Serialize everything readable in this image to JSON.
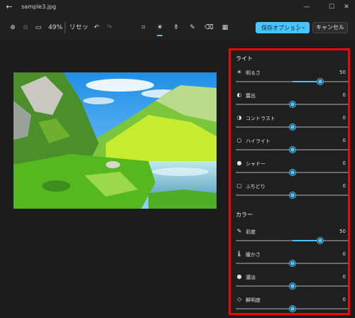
{
  "window": {
    "title": "sample3.jpg"
  },
  "toolbar": {
    "zoom_percent": "49%",
    "reset_label": "リセット",
    "save_options_label": "保存オプション",
    "cancel_label": "キャンセル"
  },
  "panel": {
    "light_section": "ライト",
    "color_section": "カラー",
    "light": [
      {
        "label": "明るさ",
        "value": "50",
        "level": 50,
        "icon": "sun-icon"
      },
      {
        "label": "露出",
        "value": "0",
        "level": 0,
        "icon": "exposure-icon"
      },
      {
        "label": "コントラスト",
        "value": "0",
        "level": 0,
        "icon": "contrast-icon"
      },
      {
        "label": "ハイライト",
        "value": "0",
        "level": 0,
        "icon": "highlight-icon"
      },
      {
        "label": "シャドー",
        "value": "0",
        "level": 0,
        "icon": "shadow-icon"
      },
      {
        "label": "ふちどり",
        "value": "0",
        "level": 0,
        "icon": "vignette-icon"
      }
    ],
    "color": [
      {
        "label": "彩度",
        "value": "50",
        "level": 50,
        "icon": "dropper-icon"
      },
      {
        "label": "暖かさ",
        "value": "0",
        "level": 0,
        "icon": "thermometer-icon"
      },
      {
        "label": "濃淡",
        "value": "0",
        "level": 0,
        "icon": "drop-icon"
      },
      {
        "label": "鮮明度",
        "value": "0",
        "level": 0,
        "icon": "diamond-icon"
      }
    ]
  },
  "colors": {
    "accent": "#4cc2ff",
    "highlight_border": "#ff0000"
  }
}
